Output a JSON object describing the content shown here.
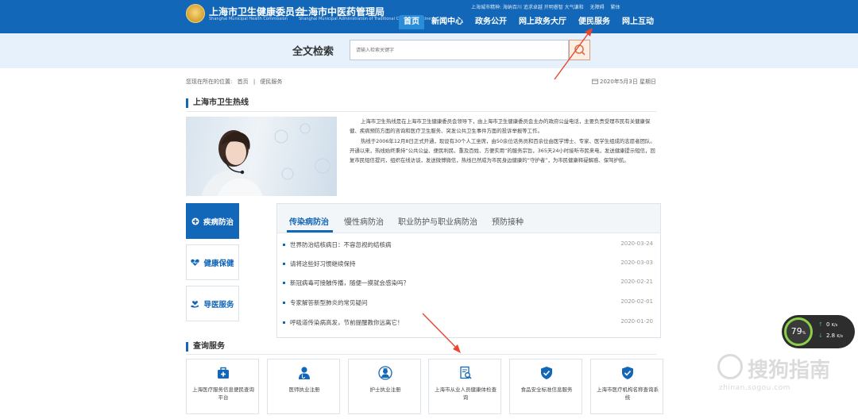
{
  "header": {
    "org_name": "上海市卫生健康委员会",
    "org_name_en": "Shanghai Municipal Health Commission",
    "org_name_2": "上海市中医药管理局",
    "org_name_2_en": "Shanghai Municipal Administration of Traditional Chinese Medicine",
    "top_links": [
      "上海城市精神: 海纳百川 追求卓越 开明睿智 大气谦和",
      "无障碍",
      "繁体"
    ],
    "nav": [
      "首页",
      "新闻中心",
      "政务公开",
      "网上政务大厅",
      "便民服务",
      "网上互动"
    ],
    "nav_active": "首页"
  },
  "search": {
    "title": "全文检索",
    "placeholder": "请输入检索关键字"
  },
  "breadcrumb": {
    "prefix": "您现在所在的位置:",
    "items": [
      "首页",
      "便民服务"
    ],
    "separator": "|",
    "date": "2020年5月3日 星期日"
  },
  "hotline": {
    "heading": "上海市卫生热线",
    "paragraphs": [
      "上海市卫生热线是在上海市卫生健康委员会领导下，由上海市卫生健康委员会主办的政府公益电话，主要负责受理市民有关健康保健、疾病预防方面的咨询和医疗卫生服务、突发公共卫生事件方面的投诉举报等工作。",
      "热线于2006年12月8日正式开通，现设有30个人工坐席，由50余位话务员和百余位由医学博士、专家、医学生组成的志愿者团队。开通以来，热线始终秉持“公共公益、便民利民、重及百姓、方便实用”的服务宗旨，365天24小时接听市民来电，发送健康提示短信，回复市民短信提问，组织在线访谈，发送微博微信，热线已然成为市民身边健康的“守护者”，为市民健康释疑解惑、保驾护航。"
    ]
  },
  "side_tabs": [
    {
      "label": "疾病防治",
      "icon": "plus-circle-icon",
      "active": true
    },
    {
      "label": "健康保健",
      "icon": "heart-pulse-icon",
      "active": false
    },
    {
      "label": "导医服务",
      "icon": "heart-hand-icon",
      "active": false
    }
  ],
  "news": {
    "tabs": [
      "传染病防治",
      "慢性病防治",
      "职业防护与职业病防治",
      "预防接种"
    ],
    "active_tab": "传染病防治",
    "items": [
      {
        "title": "世界防治结核病日：不容忽视的结核病",
        "date": "2020-03-24"
      },
      {
        "title": "请将这些好习惯继续保持",
        "date": "2020-03-03"
      },
      {
        "title": "新冠病毒可接触传播，随便一摸就会感染吗？",
        "date": "2020-02-21"
      },
      {
        "title": "专家解答新型肺炎的常见疑问",
        "date": "2020-02-01"
      },
      {
        "title": "呼吸道传染病高发，节前提醒教你远离它！",
        "date": "2020-01-20"
      }
    ]
  },
  "query": {
    "heading": "查询服务",
    "cards": [
      {
        "label": "上海医疗服务信息便民查询平台",
        "icon": "medical-kit-icon"
      },
      {
        "label": "医师执业注册",
        "icon": "doctor-icon"
      },
      {
        "label": "护士执业注册",
        "icon": "nurse-icon"
      },
      {
        "label": "上海市从业人员健康体检查询",
        "icon": "document-search-icon"
      },
      {
        "label": "食品安全标准信息服务",
        "icon": "shield-check-icon"
      },
      {
        "label": "上海市医疗机构名称查询系统",
        "icon": "shield-check-icon"
      }
    ]
  },
  "speed_widget": {
    "percent": "79",
    "percent_unit": "%",
    "upload": "0",
    "upload_unit": "K/s",
    "download": "2.8",
    "download_unit": "K/s"
  },
  "watermark": {
    "text": "搜狗指南",
    "url": "zhinan.sogou.com"
  },
  "colors": {
    "brand_blue": "#1367b8",
    "nav_active": "#2a8dd8",
    "annotation_red": "#e8462e"
  }
}
